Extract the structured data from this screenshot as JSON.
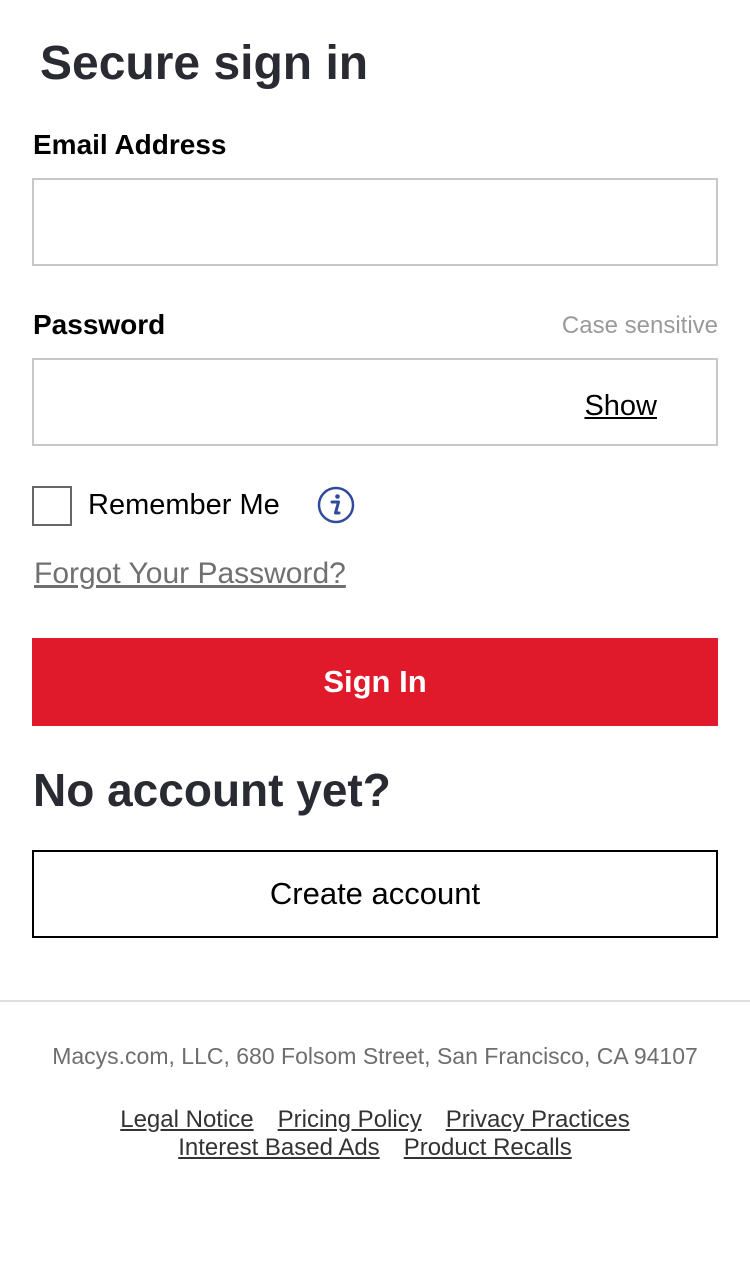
{
  "page": {
    "title": "Secure sign in"
  },
  "email": {
    "label": "Email Address",
    "value": "",
    "placeholder": ""
  },
  "password": {
    "label": "Password",
    "hint": "Case sensitive",
    "value": "",
    "placeholder": "",
    "show_label": "Show"
  },
  "remember": {
    "label": "Remember Me",
    "checked": false,
    "info_icon": "info-icon"
  },
  "forgot": {
    "label": "Forgot Your Password?"
  },
  "signin": {
    "label": "Sign In"
  },
  "no_account": {
    "heading": "No account yet?",
    "button_label": "Create account"
  },
  "footer": {
    "address": "Macys.com, LLC, 680 Folsom Street, San Francisco, CA 94107",
    "links_row1": [
      "Legal Notice",
      "Pricing Policy",
      "Privacy Practices"
    ],
    "links_row2": [
      "Interest Based Ads",
      "Product Recalls"
    ]
  },
  "colors": {
    "primary_red": "#e11a2b",
    "heading_text": "#2a2a33",
    "info_blue": "#2f4a9e",
    "muted_text": "#707070"
  }
}
